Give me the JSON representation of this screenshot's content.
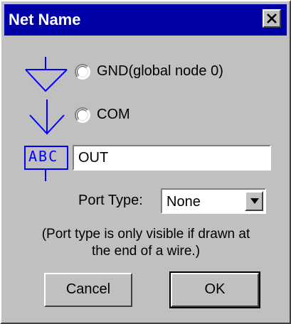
{
  "dialog": {
    "title": "Net Name",
    "close_icon": "close-icon"
  },
  "options": {
    "gnd_label": "GND(global node 0)",
    "com_label": "COM",
    "abc_symbol": "ABC"
  },
  "net_name": {
    "value": "OUT"
  },
  "port_type": {
    "label": "Port Type:",
    "selected": "None"
  },
  "note": {
    "line1": "(Port type is only visible if drawn at",
    "line2": "the end of a wire.)"
  },
  "buttons": {
    "cancel": "Cancel",
    "ok": "OK"
  }
}
